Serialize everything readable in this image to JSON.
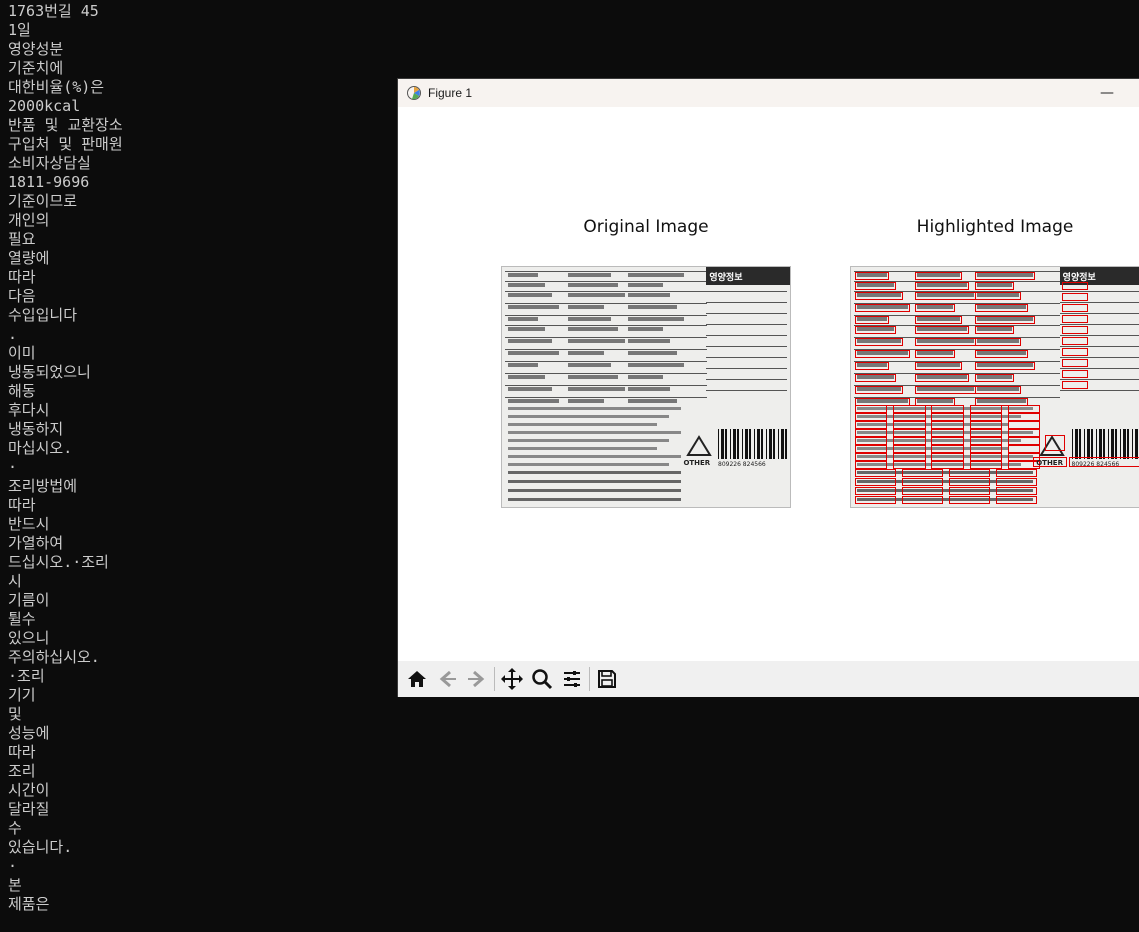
{
  "terminal": {
    "lines": [
      "1763번길 45",
      "1일",
      "영양성분",
      "기준치에",
      "대한비율(%)은",
      "2000kcal",
      "반품 및 교환장소",
      "구입처 및 판매원",
      "소비자상담실",
      "1811-9696",
      "기준이므로",
      "개인의",
      "필요",
      "열량에",
      "따라",
      "다음",
      "수입입니다",
      ".",
      "이미",
      "냉동되었으니",
      "해동",
      "후다시",
      "냉동하지",
      "마십시오.",
      "·",
      "조리방법에",
      "따라",
      "반드시",
      "가열하여",
      "드십시오.·조리",
      "시",
      "기름이",
      "튈수",
      "있으니",
      "주의하십시오.",
      "·조리",
      "기기",
      "및",
      "성능에",
      "따라",
      "조리",
      "시간이",
      "달라질",
      "수",
      "있습니다.",
      "·",
      "본",
      "제품은"
    ]
  },
  "window": {
    "title": "Figure 1",
    "minimize_glyph": "—"
  },
  "axes": {
    "left_title": "Original Image",
    "right_title": "Highlighted Image"
  },
  "package_labels": {
    "nutrition_header": "영양정보",
    "recycle_text": "OTHER",
    "barcode_number": "809226   824566"
  },
  "toolbar": {
    "buttons": [
      "home-icon",
      "back-icon",
      "forward-icon",
      "pan-icon",
      "zoom-icon",
      "configure-icon",
      "save-icon"
    ]
  },
  "colors": {
    "terminal_bg": "#0c0c0c",
    "terminal_fg": "#cccccc",
    "highlight_box": "#e00000"
  }
}
